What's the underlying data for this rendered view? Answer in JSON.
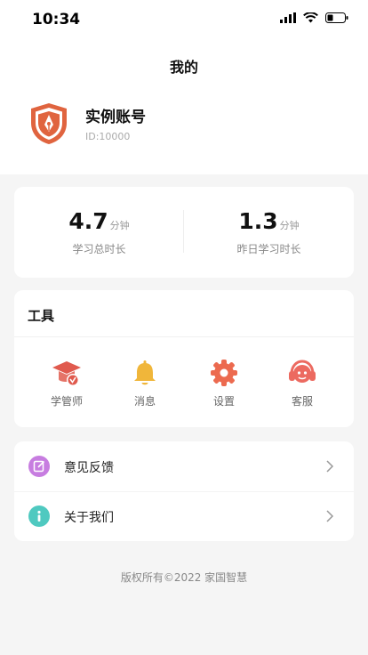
{
  "status_bar": {
    "time": "10:34"
  },
  "nav": {
    "title": "我的"
  },
  "profile": {
    "name": "实例账号",
    "id_prefix": "ID:",
    "id_value": "10000"
  },
  "stats": [
    {
      "value": "4.7",
      "unit": "分钟",
      "label": "学习总时长"
    },
    {
      "value": "1.3",
      "unit": "分钟",
      "label": "昨日学习时长"
    }
  ],
  "tools": {
    "title": "工具",
    "items": [
      {
        "label": "学管师",
        "icon": "graduation-cap-icon",
        "color": "#e05a4e"
      },
      {
        "label": "消息",
        "icon": "bell-icon",
        "color": "#f0b63a"
      },
      {
        "label": "设置",
        "icon": "gear-icon",
        "color": "#ec6a4f"
      },
      {
        "label": "客服",
        "icon": "headset-icon",
        "color": "#ec6a60"
      }
    ]
  },
  "menu": [
    {
      "label": "意见反馈",
      "icon": "edit-icon",
      "color": "#c77de0"
    },
    {
      "label": "关于我们",
      "icon": "info-icon",
      "color": "#4fc9c0"
    }
  ],
  "footer": {
    "copyright": "版权所有©2022 家国智慧"
  }
}
